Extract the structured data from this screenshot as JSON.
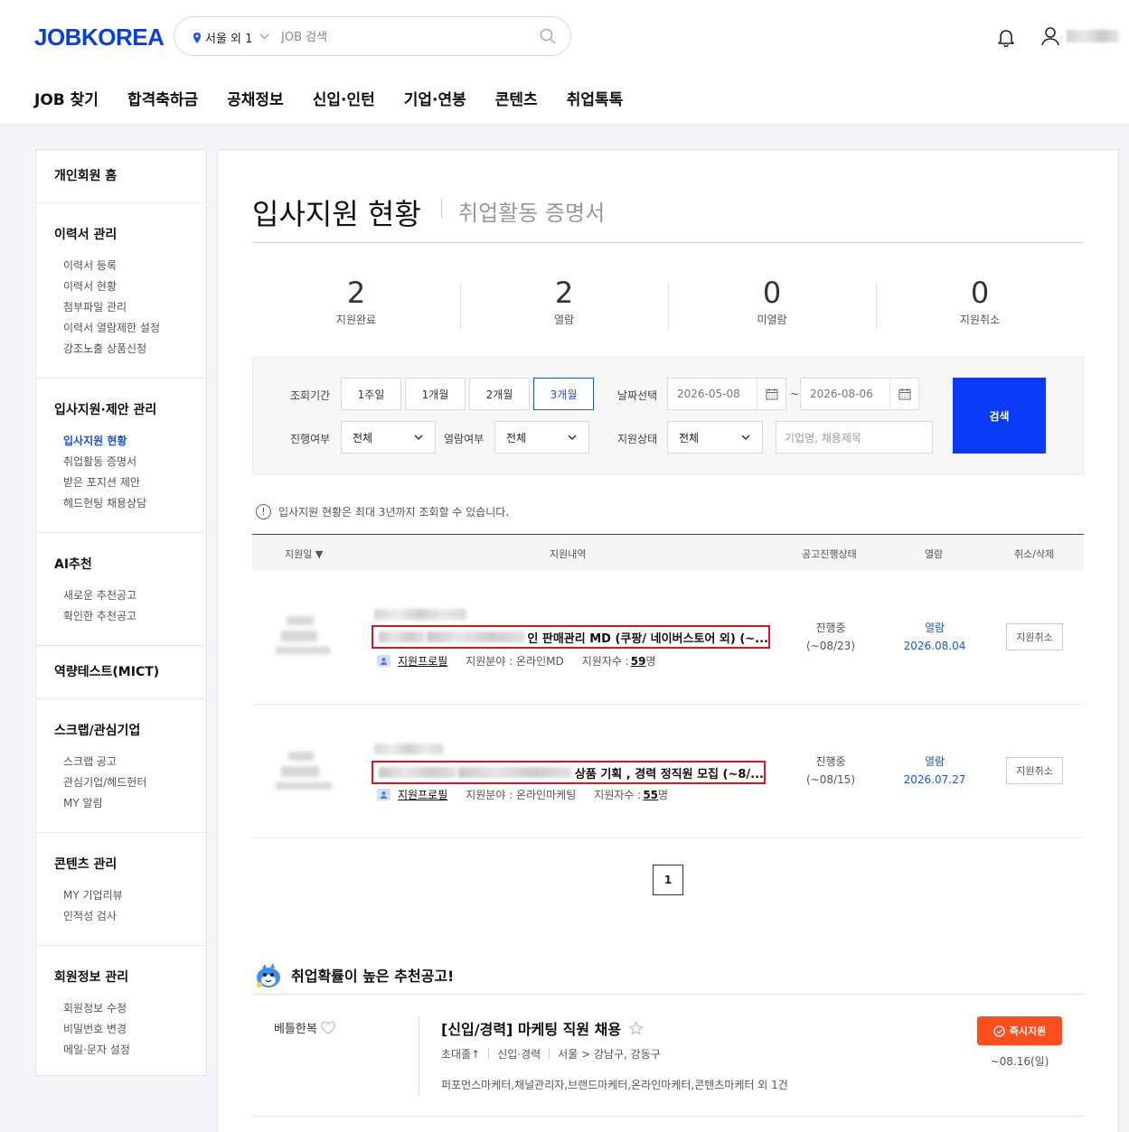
{
  "header": {
    "logo": "JOBKOREA",
    "location": "서울 외 1",
    "search_placeholder": "JOB 검색",
    "nav": [
      "JOB 찾기",
      "합격축하금",
      "공채정보",
      "신입·인턴",
      "기업·연봉",
      "콘텐츠",
      "취업톡톡"
    ]
  },
  "sidebar": {
    "sections": [
      {
        "title": "개인회원 홈",
        "items": []
      },
      {
        "title": "이력서 관리",
        "items": [
          "이력서 등록",
          "이력서 현황",
          "첨부파일 관리",
          "이력서 열람제한 설정",
          "강조노출 상품신청"
        ]
      },
      {
        "title": "입사지원·제안 관리",
        "items": [
          "입사지원 현황",
          "취업활동 증명서",
          "받은 포지션 제안",
          "헤드헌팅 채용상담"
        ]
      },
      {
        "title": "AI추천",
        "items": [
          "새로운 추천공고",
          "확인한 추천공고"
        ]
      },
      {
        "title": "역량테스트(MICT)",
        "items": []
      },
      {
        "title": "스크랩/관심기업",
        "items": [
          "스크랩 공고",
          "관심기업/헤드헌터",
          "MY 알림"
        ]
      },
      {
        "title": "콘텐츠 관리",
        "items": [
          "MY 기업리뷰",
          "인적성 검사"
        ]
      },
      {
        "title": "회원정보 관리",
        "items": [
          "회원정보 수정",
          "비밀번호 변경",
          "메일·문자 설정"
        ]
      }
    ],
    "active_item": "입사지원 현황"
  },
  "page": {
    "title": "입사지원 현황",
    "subtitle": "취업활동 증명서"
  },
  "stats": [
    {
      "value": "2",
      "label": "지원완료"
    },
    {
      "value": "2",
      "label": "열람"
    },
    {
      "value": "0",
      "label": "미열람"
    },
    {
      "value": "0",
      "label": "지원취소"
    }
  ],
  "filter": {
    "period_label": "조회기간",
    "periods": [
      "1주일",
      "1개월",
      "2개월",
      "3개월"
    ],
    "active_period": "3개월",
    "date_label": "날짜선택",
    "date_from": "2026-05-08",
    "date_to": "2026-08-06",
    "tilde": "~",
    "progress_label": "진행여부",
    "progress_value": "전체",
    "read_label": "열람여부",
    "read_value": "전체",
    "apply_status_label": "지원상태",
    "apply_status_value": "전체",
    "keyword_placeholder": "기업명, 채용제목",
    "search_button": "검색"
  },
  "notice": {
    "icon": "!",
    "text": "입사지원 현황은 최대 3년까지 조회할 수 있습니다."
  },
  "table": {
    "headers": {
      "date": "지원일 ▼",
      "detail": "지원내역",
      "status": "공고진행상태",
      "read": "열람",
      "cancel": "취소/삭제"
    },
    "rows": [
      {
        "title_visible": "인 판매관리 MD (쿠팡/ 네이버스토어 외) (~...",
        "profile_link": "지원프로필",
        "field": "지원분야 : 온라인MD",
        "applicants_label": "지원자수 :",
        "applicants": "59",
        "applicants_unit": "명",
        "status": "진행중",
        "deadline": "(~08/23)",
        "read": "열람",
        "read_date": "2026.08.04",
        "cancel": "지원취소"
      },
      {
        "title_visible": "상품 기획 , 경력 정직원 모집 (~8/...",
        "profile_link": "지원프로필",
        "field": "지원분야 : 온라인마케팅",
        "applicants_label": "지원자수 :",
        "applicants": "55",
        "applicants_unit": "명",
        "status": "진행중",
        "deadline": "(~08/15)",
        "read": "열람",
        "read_date": "2026.07.27",
        "cancel": "지원취소"
      }
    ]
  },
  "pagination": {
    "current": "1"
  },
  "recommend": {
    "heading": "취업확률이 높은 추천공고!",
    "company": "베틀한복",
    "title": "[신입/경력] 마케팅 직원 채용",
    "edu": "초대졸↑",
    "career": "신입·경력",
    "location": "서울 > 강남구, 강동구",
    "tags": "퍼포먼스마케터,채널관리자,브랜드마케터,온라인마케터,콘텐츠마케터 외 1건",
    "apply_button": "즉시지원",
    "deadline": "~08.16(일)"
  },
  "colors": {
    "brand": "#0a3fd9",
    "accent": "#1f52e8",
    "search_button": "#0a3bf5",
    "apply": "#ff4e1e",
    "highlight": "#e0121e"
  }
}
